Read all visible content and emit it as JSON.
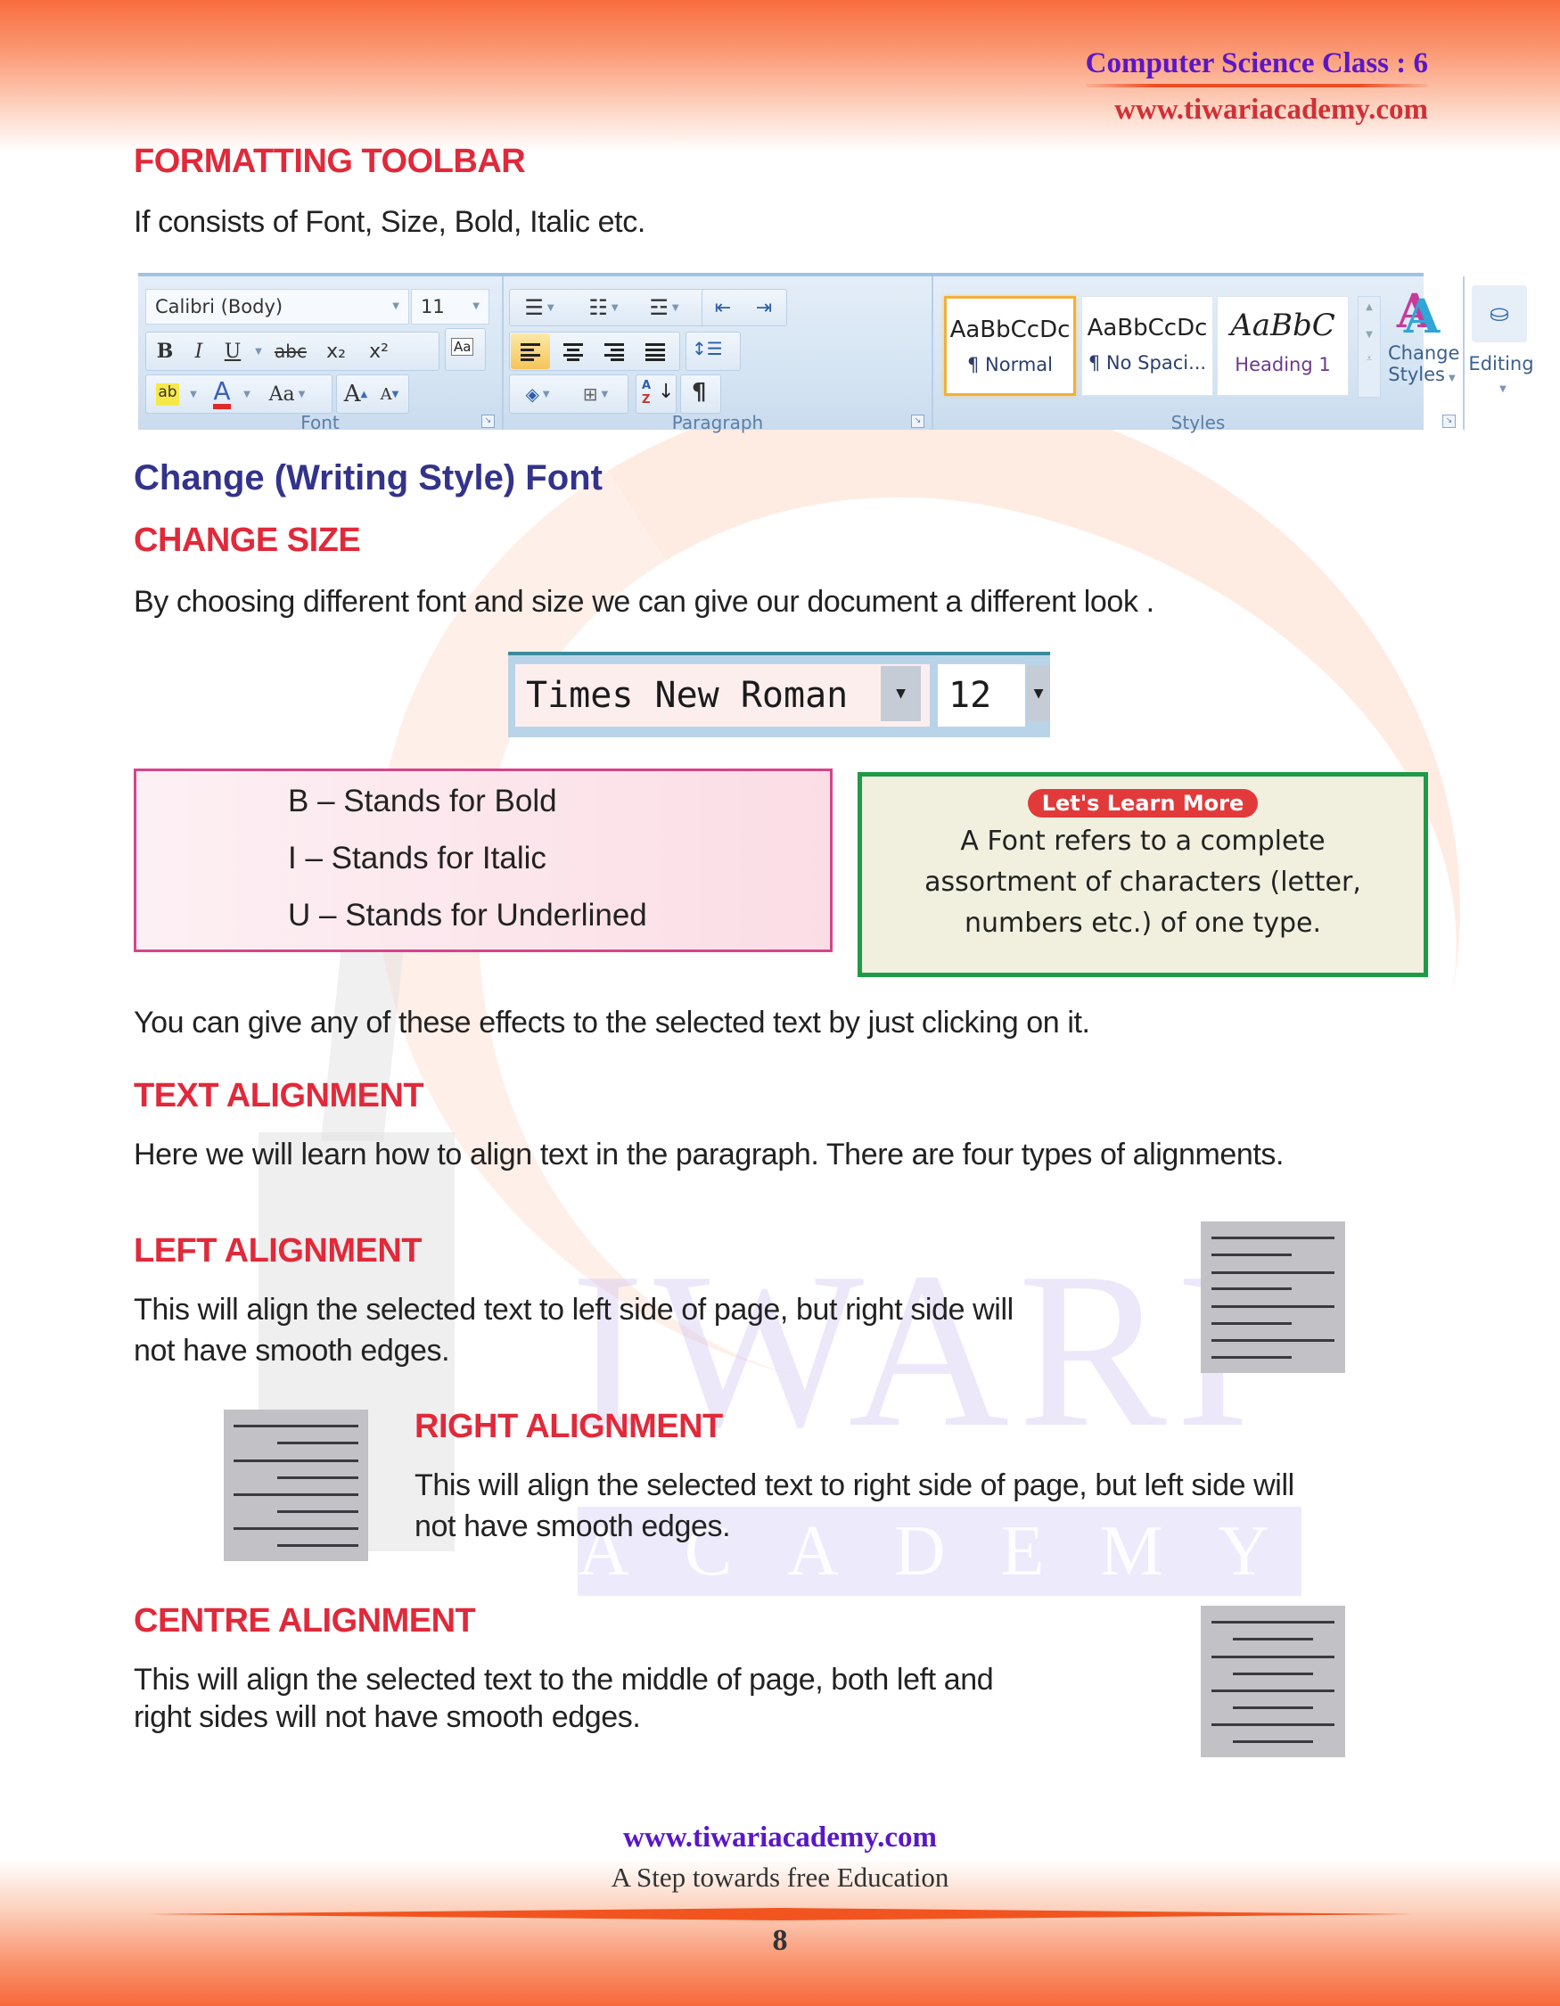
{
  "header": {
    "subject_class": "Computer Science Class : 6",
    "site_url": "www.tiwariacademy.com"
  },
  "watermark": {
    "brand_main": "IWARI",
    "brand_sub": "ACADEMY"
  },
  "sections": {
    "formatting_toolbar": {
      "heading": "FORMATTING TOOLBAR",
      "body": "If consists of Font, Size, Bold, Italic etc."
    },
    "change_font": {
      "heading": "Change (Writing Style) Font"
    },
    "change_size": {
      "heading": "CHANGE SIZE",
      "body": "By choosing different font and size we can give our document a different look ."
    },
    "effects_note": "You can give any of these effects to the selected text by just clicking on it.",
    "text_alignment": {
      "heading": "TEXT ALIGNMENT",
      "body": "Here we will learn how to align text in the paragraph. There are four types of alignments."
    },
    "left_alignment": {
      "heading": "LEFT ALIGNMENT",
      "body_line1": "This will align the selected text to left side of page, but right side will",
      "body_line2": "not have smooth edges."
    },
    "right_alignment": {
      "heading": "RIGHT ALIGNMENT",
      "body_line1": "This will align the selected text to right side of page, but left side will",
      "body_line2": "not have smooth edges."
    },
    "centre_alignment": {
      "heading": "CENTRE ALIGNMENT",
      "body_line1": "This will align the selected text to the middle of page, both left and",
      "body_line2": "right sides will not have smooth edges."
    }
  },
  "ribbon": {
    "font_group": {
      "label": "Font",
      "font_name": "Calibri (Body)",
      "font_size": "11",
      "buttons": {
        "bold": "B",
        "italic": "I",
        "underline": "U",
        "strikethrough": "abc",
        "subscript": "x₂",
        "superscript": "x²",
        "clear_formatting": "Aa",
        "highlight": "ab",
        "font_color": "A",
        "change_case": "Aa",
        "grow_font": "A",
        "shrink_font": "A"
      }
    },
    "paragraph_group": {
      "label": "Paragraph",
      "pilcrow": "¶",
      "sort": "A/Z"
    },
    "styles_group": {
      "label": "Styles",
      "tiles": [
        {
          "sample": "AaBbCcDc",
          "name": "¶ Normal",
          "active": true
        },
        {
          "sample": "AaBbCcDc",
          "name": "¶ No Spaci...",
          "active": false
        },
        {
          "sample": "AaBbC",
          "name": "Heading 1",
          "active": false
        }
      ],
      "change_styles_line1": "Change",
      "change_styles_line2": "Styles"
    },
    "editing_group": {
      "label": "Editing"
    }
  },
  "font_picker": {
    "font_name": "Times New Roman",
    "font_size": "12"
  },
  "bold_italic_box": {
    "rows": [
      {
        "letter": "B",
        "text": "Stands for Bold"
      },
      {
        "letter": "I",
        "text": "Stands for Italic"
      },
      {
        "letter": "U",
        "text": "Stands for Underlined"
      }
    ]
  },
  "learn_more": {
    "badge": "Let's Learn More",
    "line1": "A Font refers to a complete",
    "line2": "assortment of characters (letter,",
    "line3": "numbers etc.) of one type."
  },
  "footer": {
    "site_url": "www.tiwariacademy.com",
    "tagline": "A Step towards free Education",
    "page_number": "8"
  },
  "colors": {
    "heading_red": "#e1293a",
    "heading_blue": "#33338c",
    "header_purple": "#5a17c8",
    "band_orange": "#f96c3e"
  }
}
